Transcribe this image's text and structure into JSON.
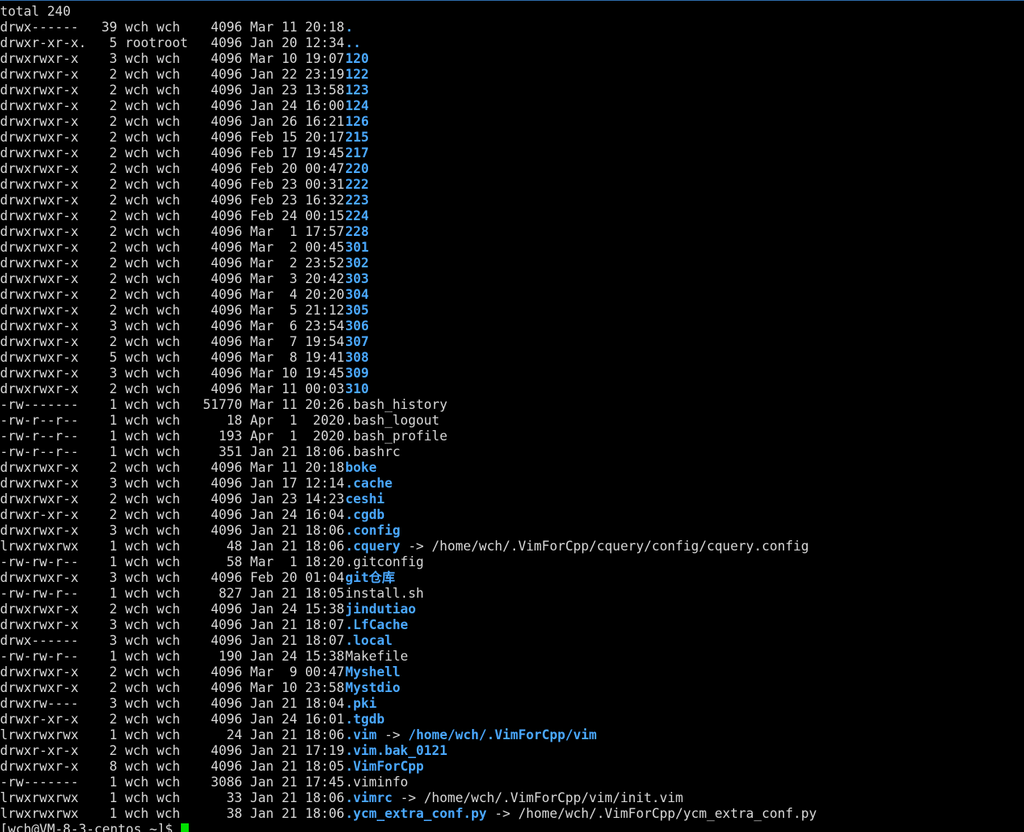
{
  "header_line": "total 240",
  "entries": [
    {
      "perm": "drwx------",
      "links": "39",
      "owner": "wch",
      "group": "wch",
      "size": "4096",
      "date": "Mar 11 20:18",
      "name": ".",
      "type": "dir"
    },
    {
      "perm": "drwxr-xr-x.",
      "links": "5",
      "owner": "root",
      "group": "root",
      "size": "4096",
      "date": "Jan 20 12:34",
      "name": "..",
      "type": "dir"
    },
    {
      "perm": "drwxrwxr-x",
      "links": "3",
      "owner": "wch",
      "group": "wch",
      "size": "4096",
      "date": "Mar 10 19:07",
      "name": "120",
      "type": "dir"
    },
    {
      "perm": "drwxrwxr-x",
      "links": "2",
      "owner": "wch",
      "group": "wch",
      "size": "4096",
      "date": "Jan 22 23:19",
      "name": "122",
      "type": "dir"
    },
    {
      "perm": "drwxrwxr-x",
      "links": "2",
      "owner": "wch",
      "group": "wch",
      "size": "4096",
      "date": "Jan 23 13:58",
      "name": "123",
      "type": "dir"
    },
    {
      "perm": "drwxrwxr-x",
      "links": "2",
      "owner": "wch",
      "group": "wch",
      "size": "4096",
      "date": "Jan 24 16:00",
      "name": "124",
      "type": "dir"
    },
    {
      "perm": "drwxrwxr-x",
      "links": "2",
      "owner": "wch",
      "group": "wch",
      "size": "4096",
      "date": "Jan 26 16:21",
      "name": "126",
      "type": "dir"
    },
    {
      "perm": "drwxrwxr-x",
      "links": "2",
      "owner": "wch",
      "group": "wch",
      "size": "4096",
      "date": "Feb 15 20:17",
      "name": "215",
      "type": "dir"
    },
    {
      "perm": "drwxrwxr-x",
      "links": "2",
      "owner": "wch",
      "group": "wch",
      "size": "4096",
      "date": "Feb 17 19:45",
      "name": "217",
      "type": "dir"
    },
    {
      "perm": "drwxrwxr-x",
      "links": "2",
      "owner": "wch",
      "group": "wch",
      "size": "4096",
      "date": "Feb 20 00:47",
      "name": "220",
      "type": "dir"
    },
    {
      "perm": "drwxrwxr-x",
      "links": "2",
      "owner": "wch",
      "group": "wch",
      "size": "4096",
      "date": "Feb 23 00:31",
      "name": "222",
      "type": "dir"
    },
    {
      "perm": "drwxrwxr-x",
      "links": "2",
      "owner": "wch",
      "group": "wch",
      "size": "4096",
      "date": "Feb 23 16:32",
      "name": "223",
      "type": "dir"
    },
    {
      "perm": "drwxrwxr-x",
      "links": "2",
      "owner": "wch",
      "group": "wch",
      "size": "4096",
      "date": "Feb 24 00:15",
      "name": "224",
      "type": "dir"
    },
    {
      "perm": "drwxrwxr-x",
      "links": "2",
      "owner": "wch",
      "group": "wch",
      "size": "4096",
      "date": "Mar  1 17:57",
      "name": "228",
      "type": "dir"
    },
    {
      "perm": "drwxrwxr-x",
      "links": "2",
      "owner": "wch",
      "group": "wch",
      "size": "4096",
      "date": "Mar  2 00:45",
      "name": "301",
      "type": "dir"
    },
    {
      "perm": "drwxrwxr-x",
      "links": "2",
      "owner": "wch",
      "group": "wch",
      "size": "4096",
      "date": "Mar  2 23:52",
      "name": "302",
      "type": "dir"
    },
    {
      "perm": "drwxrwxr-x",
      "links": "2",
      "owner": "wch",
      "group": "wch",
      "size": "4096",
      "date": "Mar  3 20:42",
      "name": "303",
      "type": "dir"
    },
    {
      "perm": "drwxrwxr-x",
      "links": "2",
      "owner": "wch",
      "group": "wch",
      "size": "4096",
      "date": "Mar  4 20:20",
      "name": "304",
      "type": "dir"
    },
    {
      "perm": "drwxrwxr-x",
      "links": "2",
      "owner": "wch",
      "group": "wch",
      "size": "4096",
      "date": "Mar  5 21:12",
      "name": "305",
      "type": "dir"
    },
    {
      "perm": "drwxrwxr-x",
      "links": "3",
      "owner": "wch",
      "group": "wch",
      "size": "4096",
      "date": "Mar  6 23:54",
      "name": "306",
      "type": "dir"
    },
    {
      "perm": "drwxrwxr-x",
      "links": "2",
      "owner": "wch",
      "group": "wch",
      "size": "4096",
      "date": "Mar  7 19:54",
      "name": "307",
      "type": "dir"
    },
    {
      "perm": "drwxrwxr-x",
      "links": "5",
      "owner": "wch",
      "group": "wch",
      "size": "4096",
      "date": "Mar  8 19:41",
      "name": "308",
      "type": "dir"
    },
    {
      "perm": "drwxrwxr-x",
      "links": "3",
      "owner": "wch",
      "group": "wch",
      "size": "4096",
      "date": "Mar 10 19:45",
      "name": "309",
      "type": "dir"
    },
    {
      "perm": "drwxrwxr-x",
      "links": "2",
      "owner": "wch",
      "group": "wch",
      "size": "4096",
      "date": "Mar 11 00:03",
      "name": "310",
      "type": "dir"
    },
    {
      "perm": "-rw-------",
      "links": "1",
      "owner": "wch",
      "group": "wch",
      "size": "51770",
      "date": "Mar 11 20:26",
      "name": ".bash_history",
      "type": "file"
    },
    {
      "perm": "-rw-r--r--",
      "links": "1",
      "owner": "wch",
      "group": "wch",
      "size": "18",
      "date": "Apr  1  2020",
      "name": ".bash_logout",
      "type": "file"
    },
    {
      "perm": "-rw-r--r--",
      "links": "1",
      "owner": "wch",
      "group": "wch",
      "size": "193",
      "date": "Apr  1  2020",
      "name": ".bash_profile",
      "type": "file"
    },
    {
      "perm": "-rw-r--r--",
      "links": "1",
      "owner": "wch",
      "group": "wch",
      "size": "351",
      "date": "Jan 21 18:06",
      "name": ".bashrc",
      "type": "file"
    },
    {
      "perm": "drwxrwxr-x",
      "links": "2",
      "owner": "wch",
      "group": "wch",
      "size": "4096",
      "date": "Mar 11 20:18",
      "name": "boke",
      "type": "dir"
    },
    {
      "perm": "drwxrwxr-x",
      "links": "3",
      "owner": "wch",
      "group": "wch",
      "size": "4096",
      "date": "Jan 17 12:14",
      "name": ".cache",
      "type": "dir"
    },
    {
      "perm": "drwxrwxr-x",
      "links": "2",
      "owner": "wch",
      "group": "wch",
      "size": "4096",
      "date": "Jan 23 14:23",
      "name": "ceshi",
      "type": "dir"
    },
    {
      "perm": "drwxr-xr-x",
      "links": "2",
      "owner": "wch",
      "group": "wch",
      "size": "4096",
      "date": "Jan 24 16:04",
      "name": ".cgdb",
      "type": "dir"
    },
    {
      "perm": "drwxrwxr-x",
      "links": "3",
      "owner": "wch",
      "group": "wch",
      "size": "4096",
      "date": "Jan 21 18:06",
      "name": ".config",
      "type": "dir"
    },
    {
      "perm": "lrwxrwxrwx",
      "links": "1",
      "owner": "wch",
      "group": "wch",
      "size": "48",
      "date": "Jan 21 18:06",
      "name": ".cquery",
      "type": "dir",
      "arrow": "->",
      "target": "/home/wch/.VimForCpp/cquery/config/cquery.config",
      "target_type": "file"
    },
    {
      "perm": "-rw-rw-r--",
      "links": "1",
      "owner": "wch",
      "group": "wch",
      "size": "58",
      "date": "Mar  1 18:20",
      "name": ".gitconfig",
      "type": "file"
    },
    {
      "perm": "drwxrwxr-x",
      "links": "3",
      "owner": "wch",
      "group": "wch",
      "size": "4096",
      "date": "Feb 20 01:04",
      "name": "git仓库",
      "type": "dir"
    },
    {
      "perm": "-rw-rw-r--",
      "links": "1",
      "owner": "wch",
      "group": "wch",
      "size": "827",
      "date": "Jan 21 18:05",
      "name": "install.sh",
      "type": "file"
    },
    {
      "perm": "drwxrwxr-x",
      "links": "2",
      "owner": "wch",
      "group": "wch",
      "size": "4096",
      "date": "Jan 24 15:38",
      "name": "jindutiao",
      "type": "dir"
    },
    {
      "perm": "drwxrwxr-x",
      "links": "3",
      "owner": "wch",
      "group": "wch",
      "size": "4096",
      "date": "Jan 21 18:07",
      "name": ".LfCache",
      "type": "dir"
    },
    {
      "perm": "drwx------",
      "links": "3",
      "owner": "wch",
      "group": "wch",
      "size": "4096",
      "date": "Jan 21 18:07",
      "name": ".local",
      "type": "dir"
    },
    {
      "perm": "-rw-rw-r--",
      "links": "1",
      "owner": "wch",
      "group": "wch",
      "size": "190",
      "date": "Jan 24 15:38",
      "name": "Makefile",
      "type": "file"
    },
    {
      "perm": "drwxrwxr-x",
      "links": "2",
      "owner": "wch",
      "group": "wch",
      "size": "4096",
      "date": "Mar  9 00:47",
      "name": "Myshell",
      "type": "dir"
    },
    {
      "perm": "drwxrwxr-x",
      "links": "2",
      "owner": "wch",
      "group": "wch",
      "size": "4096",
      "date": "Mar 10 23:58",
      "name": "Mystdio",
      "type": "dir"
    },
    {
      "perm": "drwxrw----",
      "links": "3",
      "owner": "wch",
      "group": "wch",
      "size": "4096",
      "date": "Jan 21 18:04",
      "name": ".pki",
      "type": "dir"
    },
    {
      "perm": "drwxr-xr-x",
      "links": "2",
      "owner": "wch",
      "group": "wch",
      "size": "4096",
      "date": "Jan 24 16:01",
      "name": ".tgdb",
      "type": "dir"
    },
    {
      "perm": "lrwxrwxrwx",
      "links": "1",
      "owner": "wch",
      "group": "wch",
      "size": "24",
      "date": "Jan 21 18:06",
      "name": ".vim",
      "type": "dir",
      "arrow": "->",
      "target": "/home/wch/.VimForCpp/vim",
      "target_type": "dir"
    },
    {
      "perm": "drwxr-xr-x",
      "links": "2",
      "owner": "wch",
      "group": "wch",
      "size": "4096",
      "date": "Jan 21 17:19",
      "name": ".vim.bak_0121",
      "type": "dir"
    },
    {
      "perm": "drwxrwxr-x",
      "links": "8",
      "owner": "wch",
      "group": "wch",
      "size": "4096",
      "date": "Jan 21 18:05",
      "name": ".VimForCpp",
      "type": "dir"
    },
    {
      "perm": "-rw-------",
      "links": "1",
      "owner": "wch",
      "group": "wch",
      "size": "3086",
      "date": "Jan 21 17:45",
      "name": ".viminfo",
      "type": "file"
    },
    {
      "perm": "lrwxrwxrwx",
      "links": "1",
      "owner": "wch",
      "group": "wch",
      "size": "33",
      "date": "Jan 21 18:06",
      "name": ".vimrc",
      "type": "dir",
      "arrow": "->",
      "target": "/home/wch/.VimForCpp/vim/init.vim",
      "target_type": "file"
    },
    {
      "perm": "lrwxrwxrwx",
      "links": "1",
      "owner": "wch",
      "group": "wch",
      "size": "38",
      "date": "Jan 21 18:06",
      "name": ".ycm_extra_conf.py",
      "type": "dir",
      "arrow": "->",
      "target": "/home/wch/.VimForCpp/ycm_extra_conf.py",
      "target_type": "file"
    }
  ],
  "prompt": "[wch@VM-8-3-centos ~]$ ",
  "colors": {
    "background": "#000000",
    "text": "#d8d8d8",
    "directory": "#4aa8ff",
    "cursor": "#00e000"
  }
}
